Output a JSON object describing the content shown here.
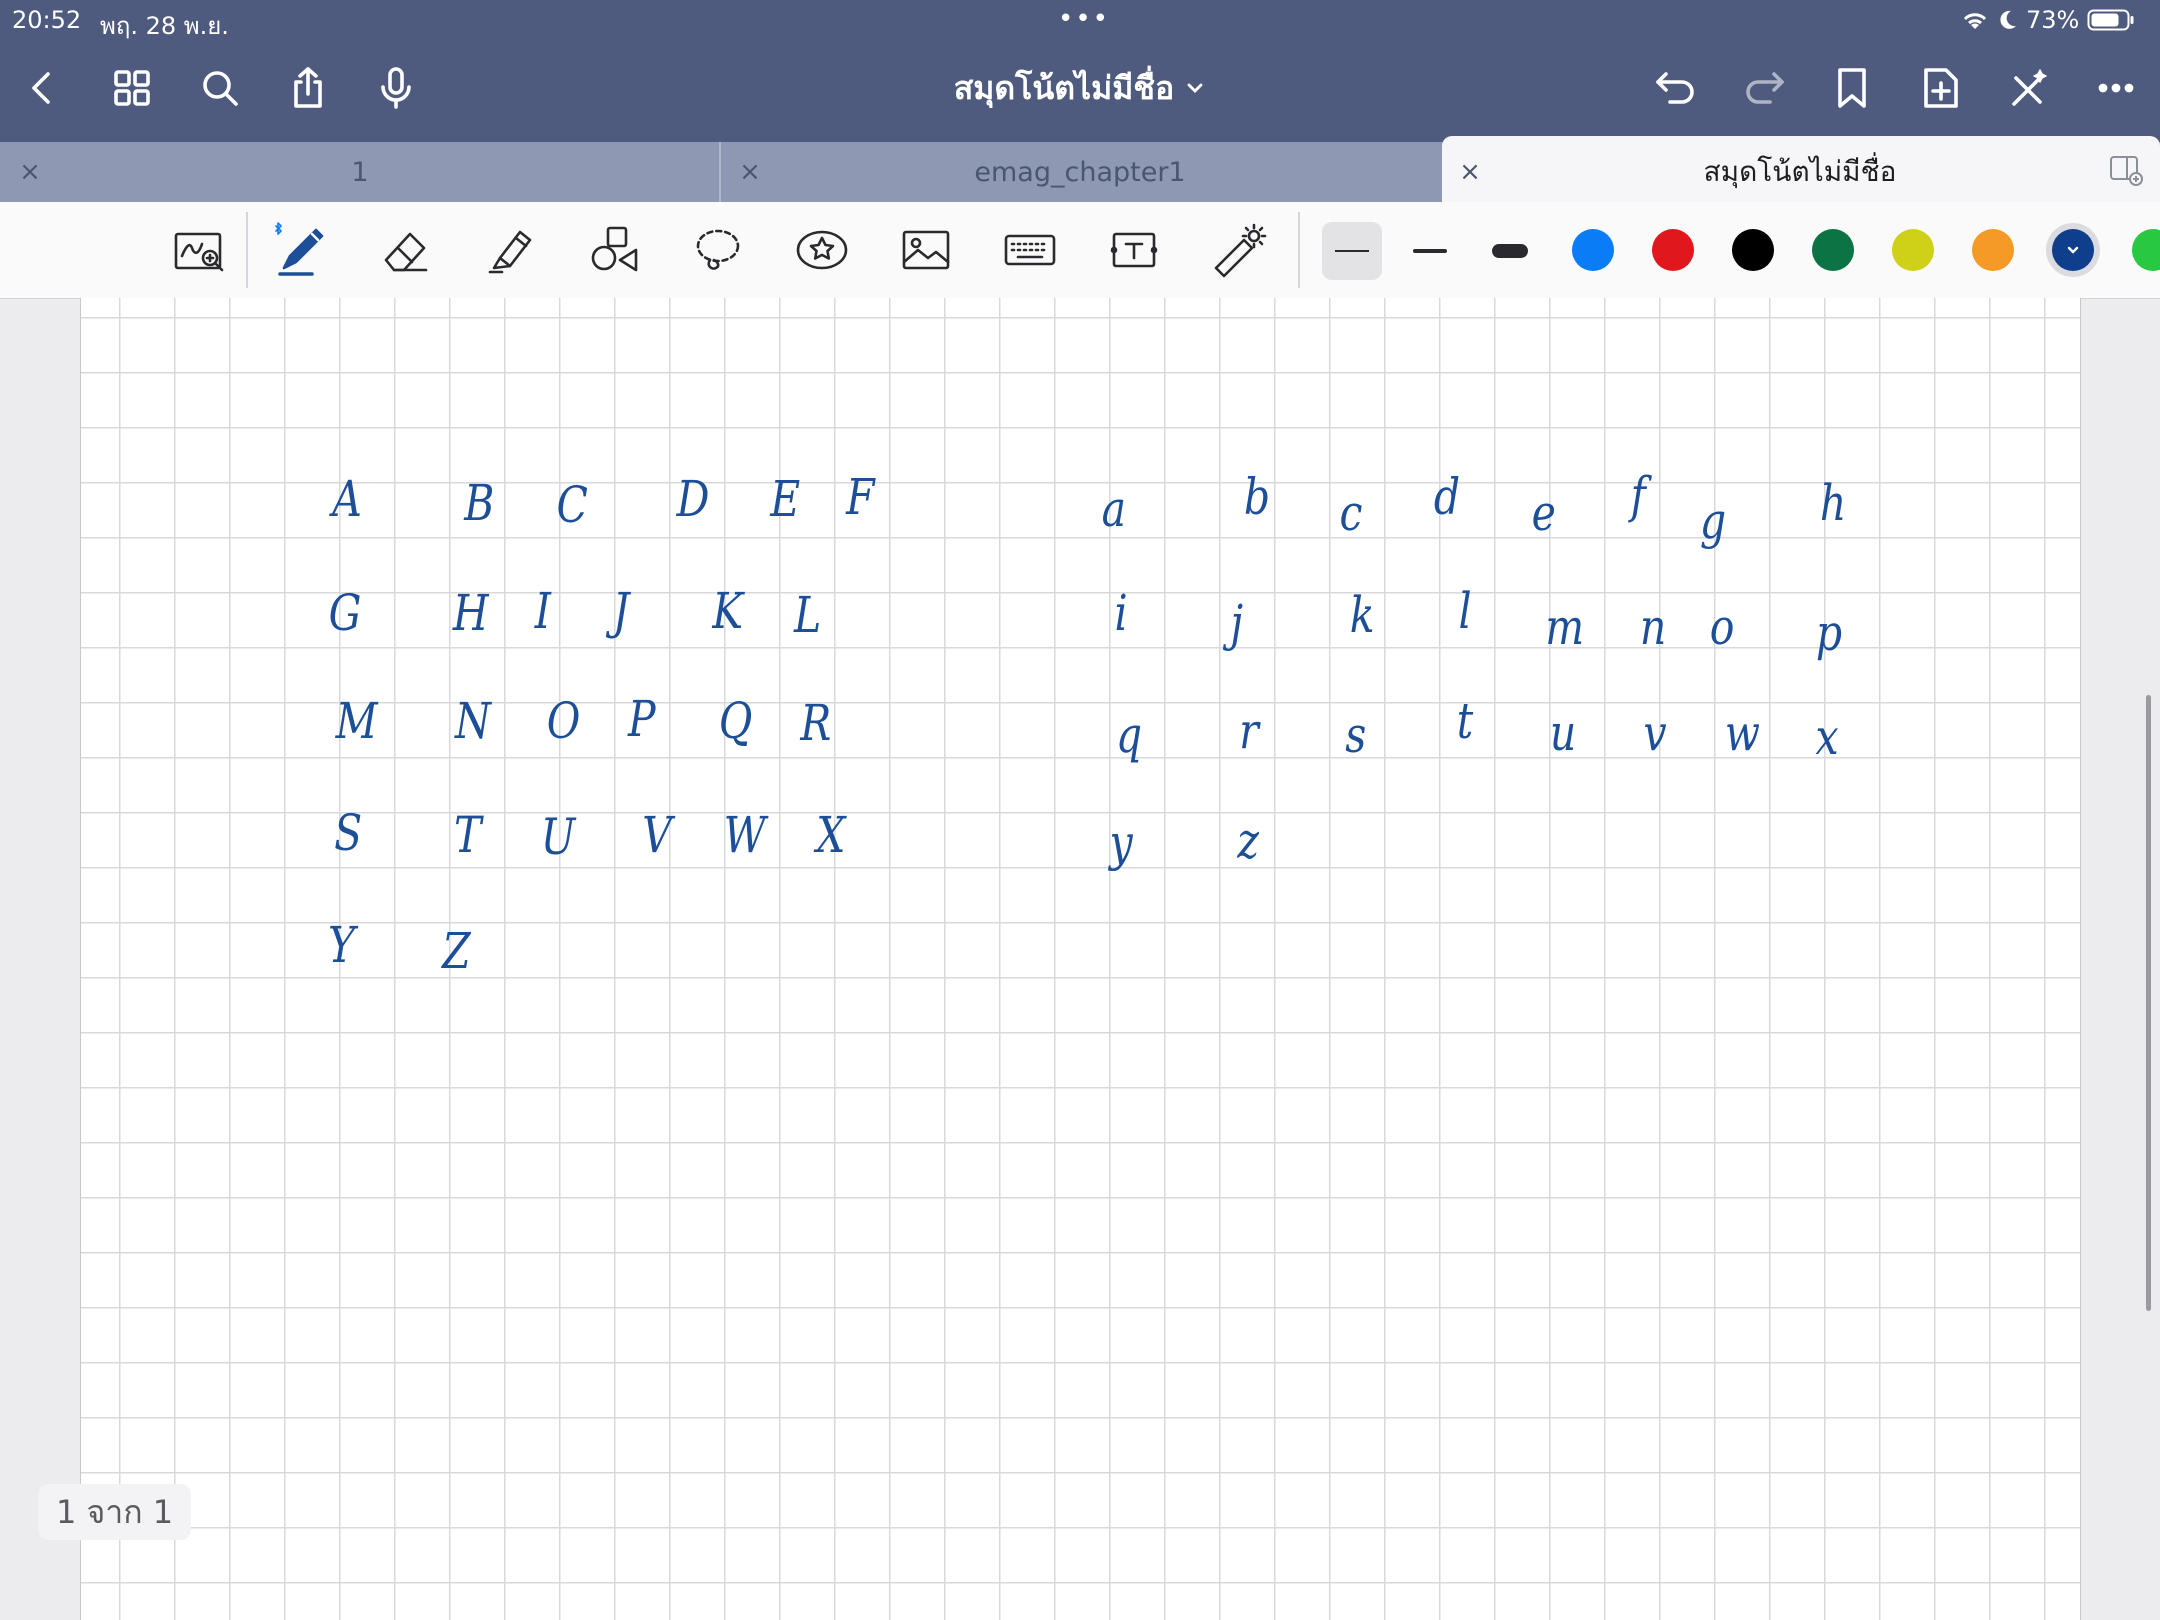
{
  "status_bar": {
    "time": "20:52",
    "date": "พฤ. 28 พ.ย.",
    "center_indicator": "•••",
    "battery": "73%"
  },
  "nav": {
    "title": "สมุดโน้ตไม่มีชื่อ",
    "left_icons": [
      "back-icon",
      "thumbnails-icon",
      "search-icon",
      "share-icon",
      "microphone-icon"
    ],
    "right_icons": [
      "undo-icon",
      "redo-icon",
      "bookmark-icon",
      "add-page-icon",
      "close-toolbar-icon",
      "more-icon"
    ]
  },
  "tabs": [
    {
      "label": "1"
    },
    {
      "label": "emag_chapter1"
    },
    {
      "label": "สมุดโน้ตไม่มีชื่อ",
      "active": true
    }
  ],
  "tab_close_glyph": "×",
  "toolbar": {
    "tools": [
      "zoom-window-icon",
      "pen-icon",
      "eraser-icon",
      "highlighter-icon",
      "shapes-icon",
      "lasso-icon",
      "stickers-icon",
      "image-icon",
      "keyboard-icon",
      "text-box-icon",
      "laser-pointer-icon"
    ],
    "stroke_widths": [
      "thin",
      "medium",
      "thick"
    ],
    "colors": [
      "#0a7cf5",
      "#e0171c",
      "#000000",
      "#0c7345",
      "#cfd018",
      "#f59a26",
      "#0f3f8c",
      "#28c840"
    ],
    "selected_color": "#0f3f8c"
  },
  "notebook": {
    "uppercase": [
      "A",
      "B",
      "C",
      "D",
      "E",
      "F",
      "G",
      "H",
      "I",
      "J",
      "K",
      "L",
      "M",
      "N",
      "O",
      "P",
      "Q",
      "R",
      "S",
      "T",
      "U",
      "V",
      "W",
      "X",
      "Y",
      "Z"
    ],
    "lowercase": [
      "a",
      "b",
      "c",
      "d",
      "e",
      "f",
      "g",
      "h",
      "i",
      "j",
      "k",
      "l",
      "m",
      "n",
      "o",
      "p",
      "q",
      "r",
      "s",
      "t",
      "u",
      "v",
      "w",
      "x",
      "y",
      "z"
    ],
    "ink_color": "#1d4f98"
  },
  "page_counter": "1 จาก 1"
}
